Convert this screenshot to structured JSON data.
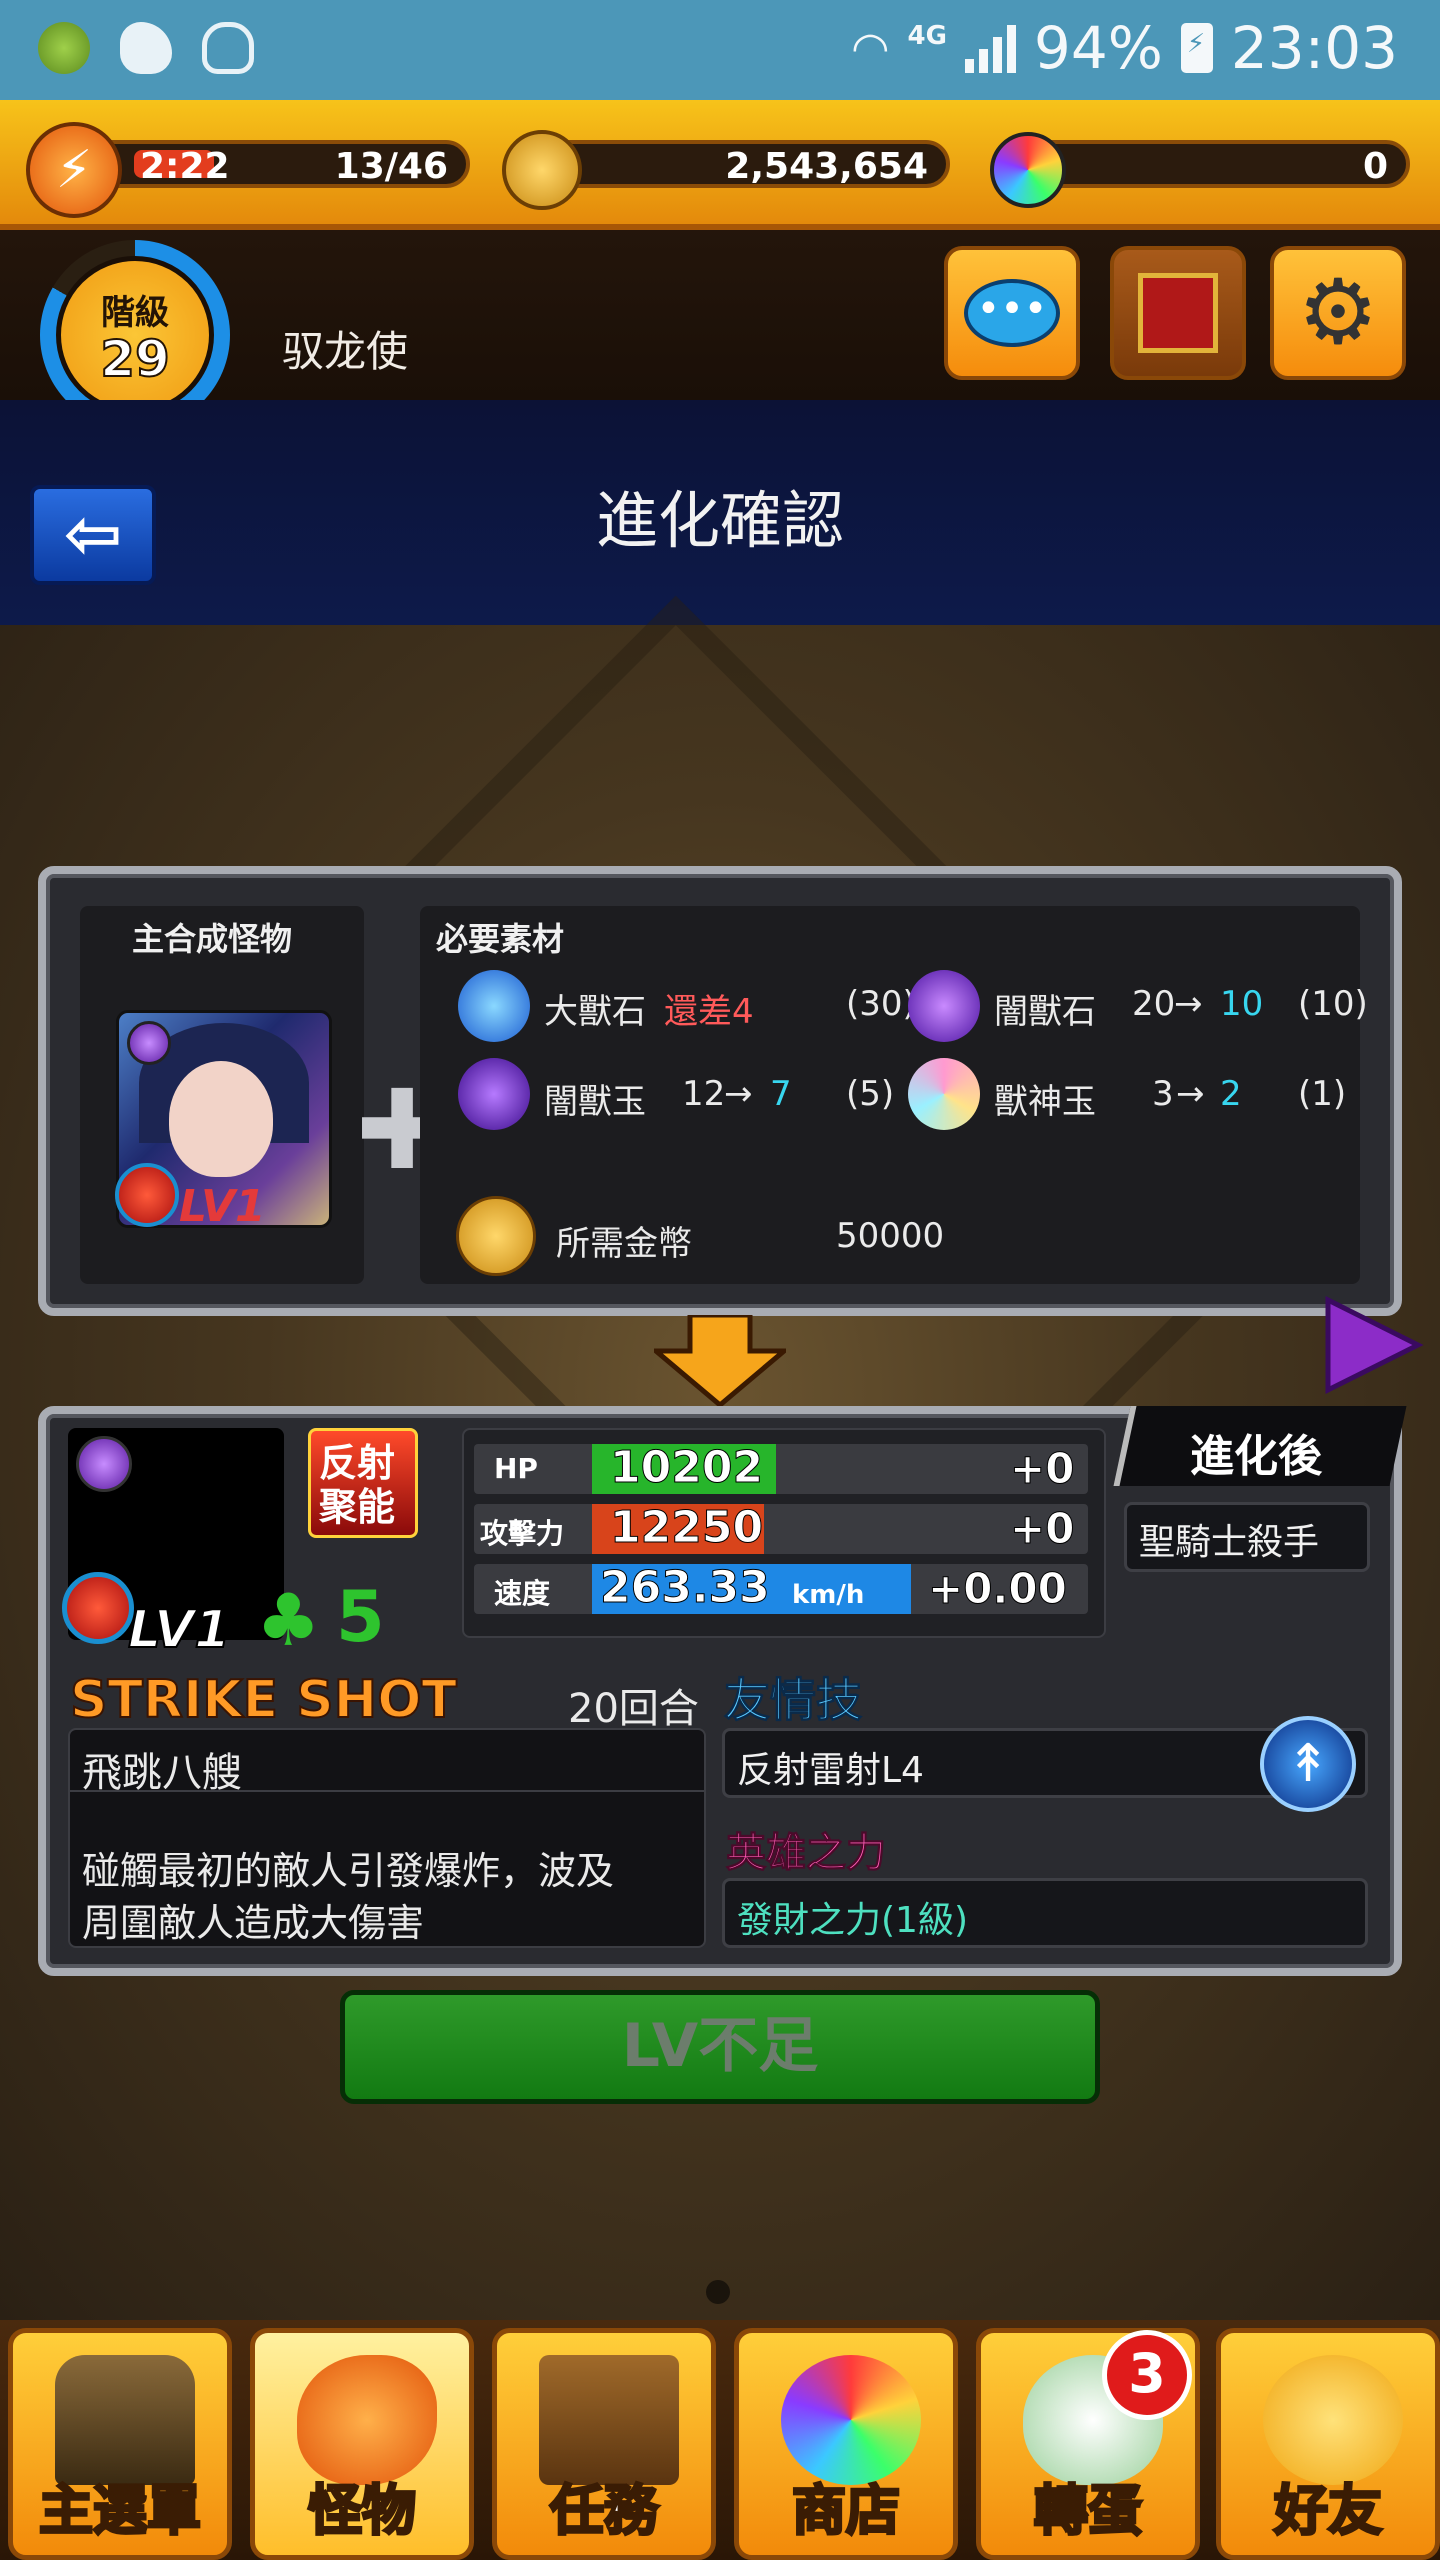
{
  "status_bar": {
    "network": "4G",
    "battery": "94%",
    "time": "23:03",
    "icons": [
      "game-icon",
      "weather-icon",
      "qq-icon",
      "wifi-icon",
      "signal-icon",
      "battery-icon"
    ]
  },
  "hud": {
    "stamina_timer": "2:22",
    "stamina": "13/46",
    "coins": "2,543,654",
    "orbs": "0",
    "rank_label": "階級",
    "rank": "29",
    "player_name": "驭龙使"
  },
  "title": "進化確認",
  "synthesis": {
    "main_label": "主合成怪物",
    "portrait_level": "LV1",
    "materials_label": "必要素材",
    "materials": [
      {
        "name": "大獸石",
        "status": "還差4",
        "req": "(30)",
        "color": "#2f7fe0"
      },
      {
        "name": "闇獸石",
        "from": "20",
        "to": "10",
        "req": "(10)",
        "color": "#7d3ad0"
      },
      {
        "name": "闇獸玉",
        "from": "12",
        "to": "7",
        "req": "(5)",
        "color": "#6a2fc4"
      },
      {
        "name": "獸神玉",
        "from": "3",
        "to": "2",
        "req": "(1)",
        "color": "#e8a0d0"
      }
    ],
    "arrow": "→",
    "gold_label": "所需金幣",
    "gold_value": "50000"
  },
  "result": {
    "level": "LV1",
    "luck": "5",
    "ability_badge": "反射聚能",
    "after_tag": "進化後",
    "name": "聖騎士殺手",
    "stats": [
      {
        "label": "HP",
        "value": "10202",
        "delta": "+0",
        "fill": 0.3,
        "color": "#27b52b"
      },
      {
        "label": "攻擊力",
        "value": "12250",
        "delta": "+0",
        "fill": 0.28,
        "color": "#d8441b"
      },
      {
        "label": "速度",
        "value": "263.33",
        "unit": "km/h",
        "delta": "+0.00",
        "fill": 0.52,
        "color": "#1e88e5"
      }
    ],
    "strike_label": "STRIKE SHOT",
    "strike_turns": "20回合",
    "strike_name": "飛跳八艘",
    "strike_desc_1": "碰觸最初的敵人引發爆炸，波及",
    "strike_desc_2": "周圍敵人造成大傷害",
    "friend_label": "友情技",
    "friend_skill": "反射雷射L4",
    "hero_label": "英雄之力",
    "hero_skill": "發財之力(1級)"
  },
  "action_button": "LV不足",
  "nav": {
    "items": [
      {
        "label": "主選單",
        "icon": "gate-icon"
      },
      {
        "label": "怪物",
        "icon": "monster-icon"
      },
      {
        "label": "任務",
        "icon": "book-icon"
      },
      {
        "label": "商店",
        "icon": "orb-icon"
      },
      {
        "label": "轉蛋",
        "icon": "egg-icon"
      },
      {
        "label": "好友",
        "icon": "friends-icon"
      }
    ],
    "gacha_badge": "3"
  }
}
